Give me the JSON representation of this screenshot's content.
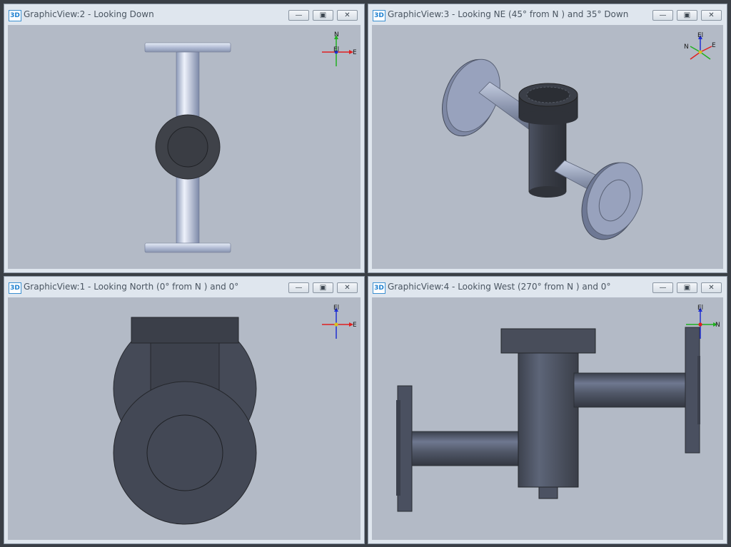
{
  "views": [
    {
      "title": "GraphicView:2 - Looking Down",
      "axis_labels": [
        "N",
        "El",
        "E"
      ],
      "buttons": {
        "minimize": "—",
        "restore": "▣",
        "close": "✕"
      }
    },
    {
      "title": "GraphicView:3 - Looking NE (45° from N ) and 35° Down",
      "axis_labels": [
        "El",
        "N",
        "E"
      ],
      "buttons": {
        "minimize": "—",
        "restore": "▣",
        "close": "✕"
      }
    },
    {
      "title": "GraphicView:1 - Looking North (0° from N ) and 0°",
      "axis_labels": [
        "El",
        "E"
      ],
      "buttons": {
        "minimize": "—",
        "restore": "▣",
        "close": "✕"
      }
    },
    {
      "title": "GraphicView:4 - Looking West (270° from N ) and 0°",
      "axis_labels": [
        "El",
        "N"
      ],
      "buttons": {
        "minimize": "—",
        "restore": "▣",
        "close": "✕"
      }
    }
  ],
  "badge": "3D",
  "colors": {
    "viewport_bg": "#b3bac6",
    "pipe_light": "#c6d0e8",
    "pipe_dark": "#4a5060",
    "axis_x": "#e02020",
    "axis_y": "#20b020",
    "axis_z": "#2030d0"
  }
}
